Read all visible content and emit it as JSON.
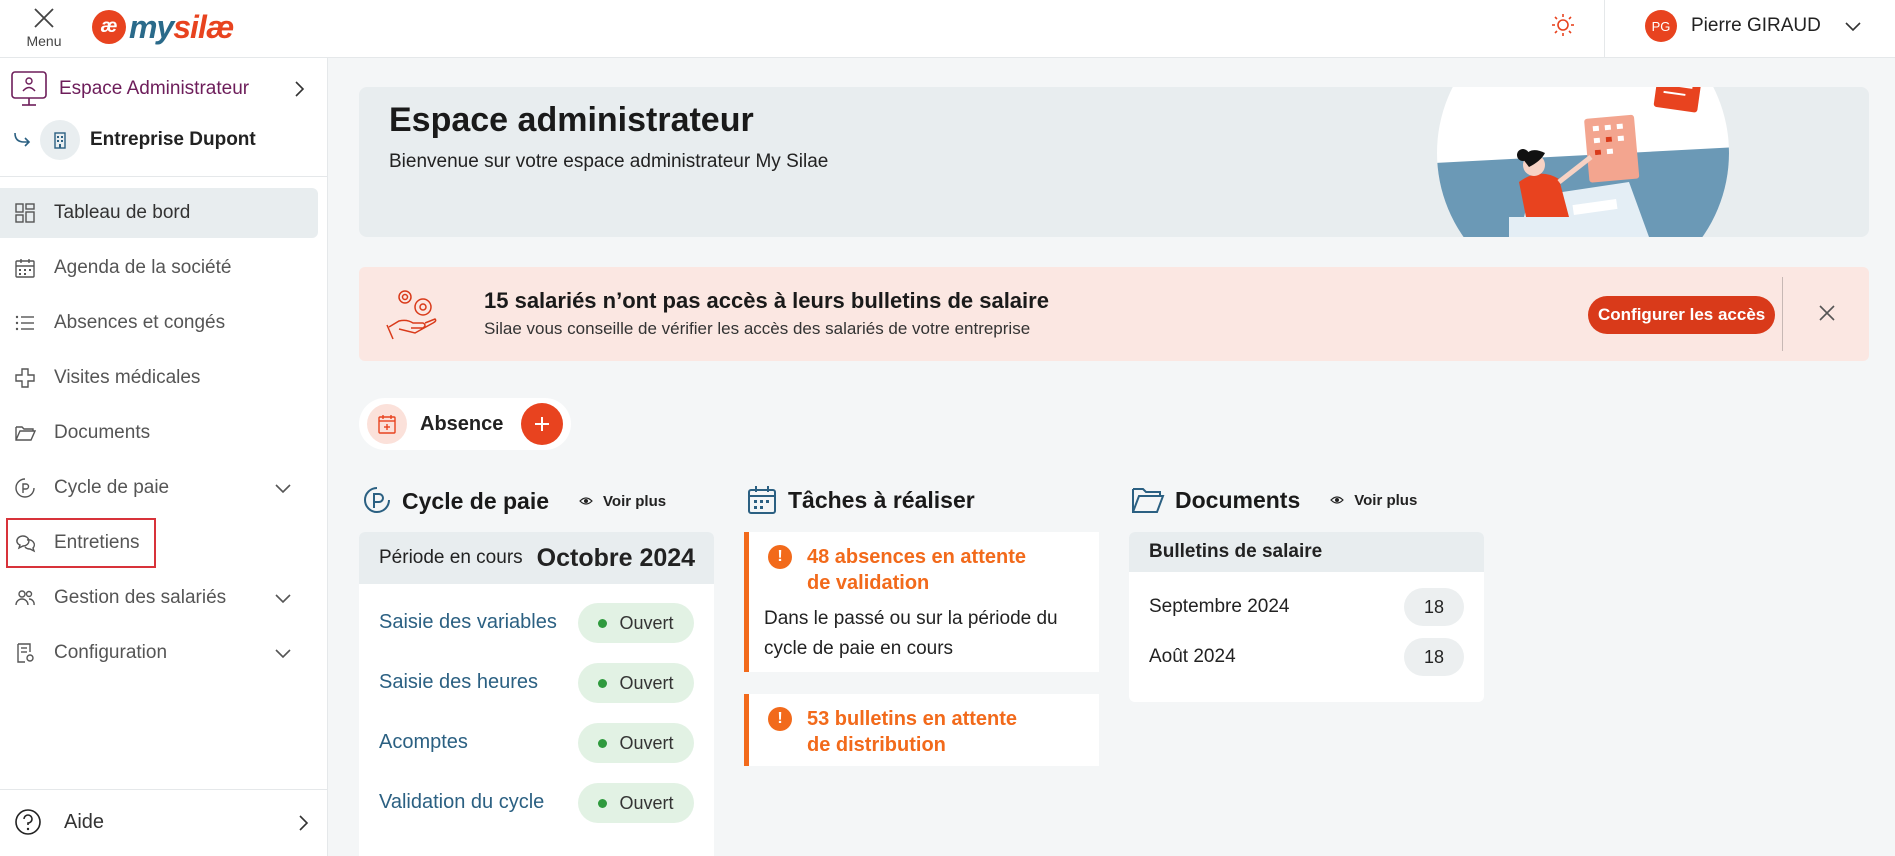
{
  "topbar": {
    "menu_label": "Menu",
    "logo_mark": "æ",
    "logo_my": "my",
    "logo_name": "silæ",
    "user_initials": "PG",
    "user_name": "Pierre GIRAUD",
    "accent_color": "#e8431f"
  },
  "sidebar": {
    "espace_label": "Espace Administrateur",
    "company_label": "Entreprise Dupont",
    "items": [
      {
        "label": "Tableau de bord",
        "icon": "dashboard-icon",
        "active": true
      },
      {
        "label": "Agenda de la société",
        "icon": "calendar-icon"
      },
      {
        "label": "Absences et congés",
        "icon": "list-icon"
      },
      {
        "label": "Visites médicales",
        "icon": "medical-cross-icon"
      },
      {
        "label": "Documents",
        "icon": "folder-icon"
      },
      {
        "label": "Cycle de paie",
        "icon": "payroll-icon",
        "expandable": true
      },
      {
        "label": "Entretiens",
        "icon": "chat-bubbles-icon",
        "highlighted": true
      },
      {
        "label": "Gestion des salariés",
        "icon": "users-icon",
        "expandable": true
      },
      {
        "label": "Configuration",
        "icon": "settings-doc-icon",
        "expandable": true
      }
    ],
    "help_label": "Aide"
  },
  "banner": {
    "title": "Espace administrateur",
    "subtitle": "Bienvenue sur votre espace administrateur My Silae"
  },
  "alert": {
    "title": "15 salariés n’ont pas accès à leurs bulletins de salaire",
    "subtitle": "Silae vous conseille de vérifier les accès des salariés de votre entreprise",
    "button_label": "Configurer les accès",
    "background_color": "#fbe7e2"
  },
  "quick_action": {
    "label": "Absence"
  },
  "cycle": {
    "title": "Cycle de paie",
    "voir_plus": "Voir plus",
    "period_label": "Période en cours",
    "period_value": "Octobre 2024",
    "rows": [
      {
        "label": "Saisie des variables",
        "status": "Ouvert"
      },
      {
        "label": "Saisie des heures",
        "status": "Ouvert"
      },
      {
        "label": "Acomptes",
        "status": "Ouvert"
      },
      {
        "label": "Validation du cycle",
        "status": "Ouvert"
      }
    ]
  },
  "tasks": {
    "title": "Tâches à réaliser",
    "items": [
      {
        "title": "48 absences en attente de validation",
        "description": "Dans le passé ou sur la période du cycle de paie en cours"
      },
      {
        "title": "53 bulletins en attente de distribution"
      }
    ],
    "warning_color": "#f26a1b"
  },
  "documents": {
    "title": "Documents",
    "voir_plus": "Voir plus",
    "section_label": "Bulletins de salaire",
    "rows": [
      {
        "label": "Septembre 2024",
        "count": "18"
      },
      {
        "label": "Août 2024",
        "count": "18"
      }
    ]
  }
}
